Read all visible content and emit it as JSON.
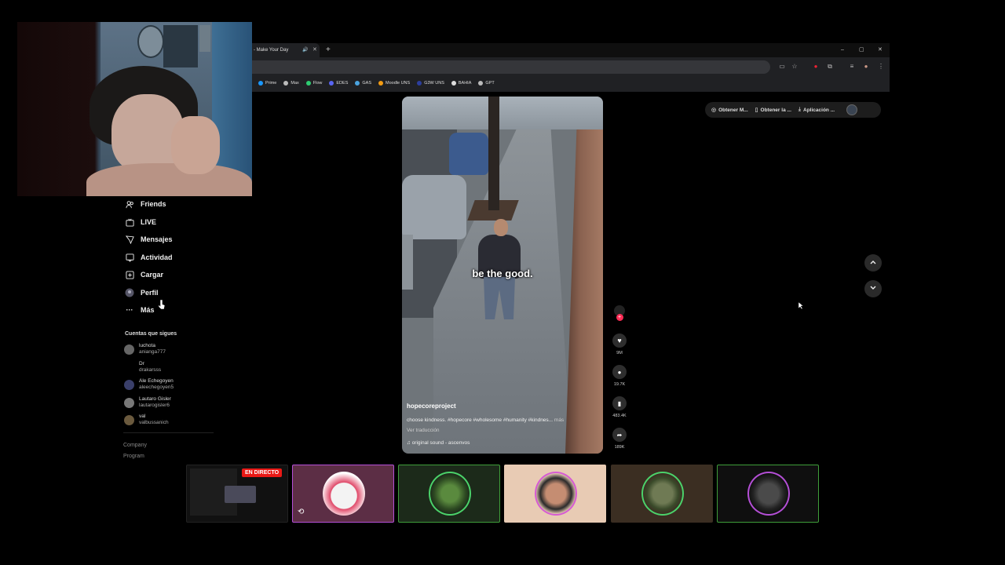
{
  "browser": {
    "tab_title": "- Make Your Day",
    "tab_mute_icon": "speaker-icon",
    "new_tab": "+",
    "window_controls": [
      "–",
      "▢",
      "✕"
    ],
    "bookmarks": [
      {
        "label": "Prime",
        "color": "#1a98ff"
      },
      {
        "label": "Max",
        "color": "#bbbbbb"
      },
      {
        "label": "Flow",
        "color": "#2ecc71"
      },
      {
        "label": "EDES",
        "color": "#5865f2"
      },
      {
        "label": "GAS",
        "color": "#4aa3df"
      },
      {
        "label": "Moodle UNS",
        "color": "#f39c12"
      },
      {
        "label": "G3W UNS",
        "color": "#2c3e9e"
      },
      {
        "label": "BAHIA",
        "color": "#dddddd"
      },
      {
        "label": "GPT",
        "color": "#bbbbbb"
      }
    ]
  },
  "sidebar": {
    "items": [
      {
        "label": "Friends",
        "icon": "friends-icon"
      },
      {
        "label": "LIVE",
        "icon": "live-icon"
      },
      {
        "label": "Mensajes",
        "icon": "messages-icon"
      },
      {
        "label": "Actividad",
        "icon": "activity-icon"
      },
      {
        "label": "Cargar",
        "icon": "upload-icon"
      },
      {
        "label": "Perfil",
        "icon": "profile-icon"
      },
      {
        "label": "Más",
        "icon": "more-icon"
      }
    ],
    "following_title": "Cuentas que sigues",
    "accounts": [
      {
        "name": "luchota",
        "user": "anianga777"
      },
      {
        "name": "Dr",
        "user": "drakarsss"
      },
      {
        "name": "Ale Echegoyen",
        "user": "aleechegoyen5"
      },
      {
        "name": "Lautaro Gisler",
        "user": "lautarogisler6"
      },
      {
        "name": "val",
        "user": "valbussanich"
      }
    ],
    "footer": [
      "Company",
      "Program"
    ]
  },
  "video": {
    "caption": "be the good.",
    "author": "hopecoreproject",
    "description": "choose kindness. #hopecore #wholesome #humanity #kindnes...",
    "more_label": "más",
    "translate_label": "Ver traducción",
    "sound": "original sound - ascenvos"
  },
  "actions": {
    "likes": "9M",
    "comments": "19.7K",
    "saves": "483.4K",
    "shares": "189K"
  },
  "top_right": {
    "buttons": [
      {
        "label": "Obtener M...",
        "icon": "coin-icon"
      },
      {
        "label": "Obtener la ...",
        "icon": "phone-icon"
      },
      {
        "label": "Aplicación ...",
        "icon": "download-icon"
      }
    ]
  },
  "stream": {
    "live_badge": "EN DIRECTO"
  },
  "colors": {
    "accent": "#fe2c55",
    "live_red": "#e91916",
    "card_border_green": "#3f9e3a",
    "card_border_purple": "#b44fd6"
  }
}
